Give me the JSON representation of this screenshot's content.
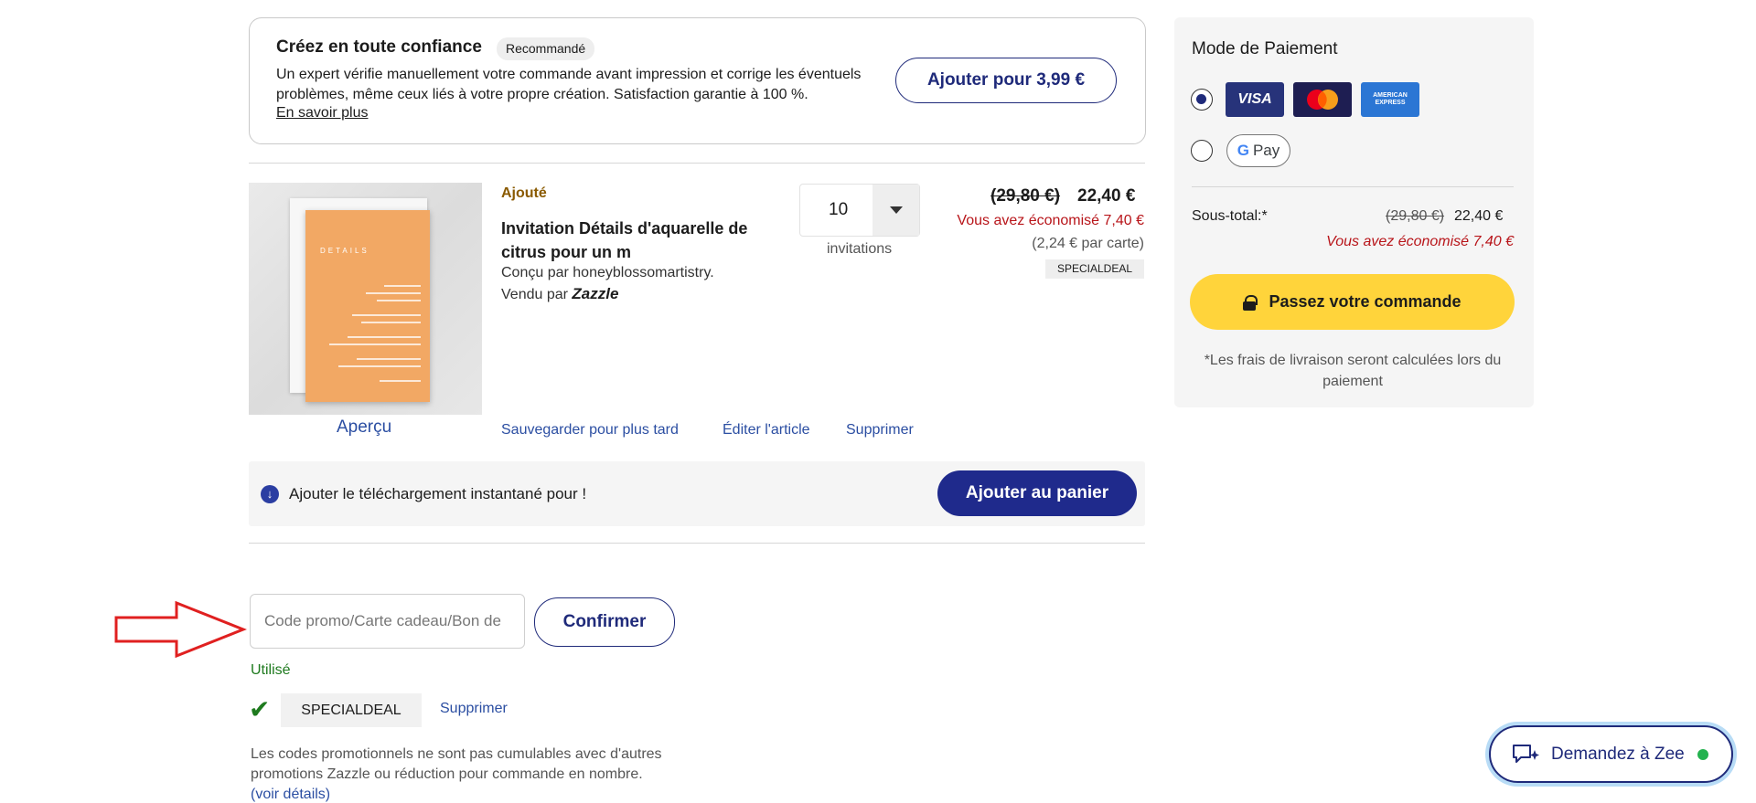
{
  "trust_card": {
    "title": "Créez en toute confiance",
    "badge": "Recommandé",
    "description": "Un expert vérifie manuellement votre commande avant impression et corrige les éventuels problèmes, même ceux liés à votre propre création. Satisfaction garantie à 100 %.",
    "learn_more": "En savoir plus",
    "add_button": "Ajouter pour 3,99 €"
  },
  "item": {
    "status": "Ajouté",
    "name": "Invitation Détails d'aquarelle de citrus pour un m",
    "designer": "Conçu par honeyblossomartistry.",
    "seller_prefix": "Vendu par",
    "seller_name": "Zazzle",
    "preview_label": "Aperçu",
    "card_text": "DETAILS",
    "quantity": "10",
    "quantity_unit": "invitations",
    "price_old": "(29,80 €)",
    "price_new": "22,40 €",
    "saved": "Vous avez économisé 7,40 €",
    "per_card": "(2,24 € par carte)",
    "promo_tag": "SPECIALDEAL",
    "actions": {
      "save_later": "Sauvegarder pour plus tard",
      "edit": "Éditer l'article",
      "delete": "Supprimer"
    }
  },
  "instant_download": {
    "text": "Ajouter le téléchargement instantané pour !",
    "button": "Ajouter au panier"
  },
  "promo": {
    "placeholder": "Code promo/Carte cadeau/Bon de",
    "confirm_button": "Confirmer",
    "status": "Utilisé",
    "applied_code": "SPECIALDEAL",
    "remove": "Supprimer",
    "note": "Les codes promotionnels ne sont pas cumulables avec d'autres promotions Zazzle ou réduction pour commande en nombre.",
    "details_link": "(voir détails)"
  },
  "payment": {
    "title": "Mode de Paiement",
    "visa": "VISA",
    "amex": "AMERICAN EXPRESS",
    "gpay": "Pay",
    "gpay_g": "G",
    "subtotal_label": "Sous-total:*",
    "subtotal_old": "(29,80 €)",
    "subtotal_new": "22,40 €",
    "subtotal_saved": "Vous avez économisé 7,40 €",
    "order_button": "Passez votre commande",
    "shipping_note": "*Les frais de livraison seront calculées lors du paiement"
  },
  "chat": {
    "label": "Demandez à Zee",
    "status_color": "#24b24f"
  },
  "colors": {
    "brand_navy": "#1f2a7a",
    "savings_red": "#b8151a",
    "order_yellow": "#ffd43b",
    "success_green": "#1e7a1e"
  }
}
